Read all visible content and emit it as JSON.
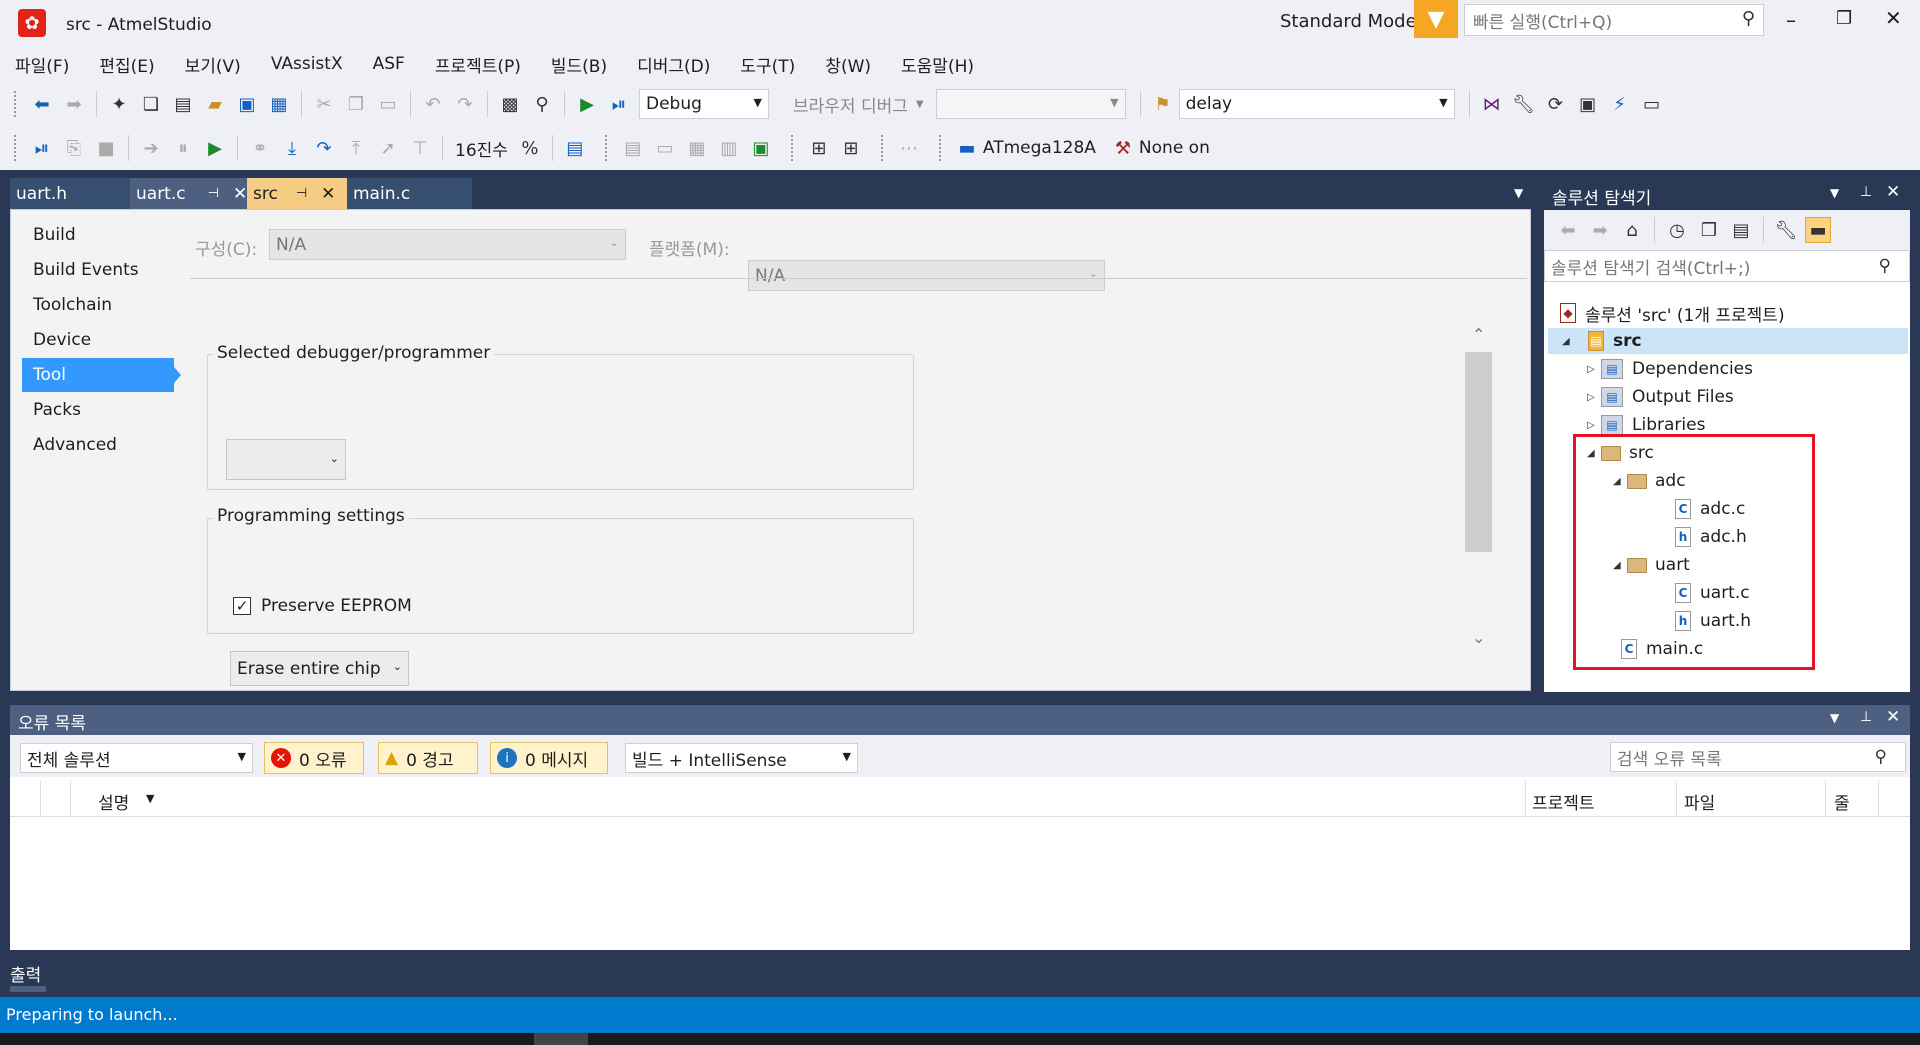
{
  "window": {
    "title": "src - AtmelStudio",
    "mode": "Standard Mode",
    "quick_launch_placeholder": "빠른 실행(Ctrl+Q)"
  },
  "menu": [
    "파일(F)",
    "편집(E)",
    "보기(V)",
    "VAssistX",
    "ASF",
    "프로젝트(P)",
    "빌드(B)",
    "디버그(D)",
    "도구(T)",
    "창(W)",
    "도움말(H)"
  ],
  "toolbar": {
    "config": "Debug",
    "browser_debugger": "브라우저 디버그",
    "search_value": "delay",
    "hex_label": "16진수",
    "device": "ATmega128A",
    "tool": "None on"
  },
  "tabs": [
    {
      "label": "uart.h"
    },
    {
      "label": "uart.c"
    },
    {
      "label": "src"
    },
    {
      "label": "main.c"
    }
  ],
  "props": {
    "nav": [
      "Build",
      "Build Events",
      "Toolchain",
      "Device",
      "Tool",
      "Packs",
      "Advanced"
    ],
    "selected_nav": "Tool",
    "config_label": "구성(C):",
    "config_value": "N/A",
    "platform_label": "플랫폼(M):",
    "platform_value": "N/A",
    "debugger_group": "Selected debugger/programmer",
    "programming_group": "Programming settings",
    "erase_value": "Erase entire chip",
    "preserve_eeprom": "Preserve EEPROM",
    "preserve_checked": true
  },
  "solution_explorer": {
    "title": "솔루션 탐색기",
    "search_placeholder": "솔루션 탐색기 검색(Ctrl+;)",
    "solution": "솔루션 'src' (1개 프로젝트)",
    "project": "src",
    "items": [
      "Dependencies",
      "Output Files",
      "Libraries"
    ],
    "folder_src": "src",
    "folder_adc": "adc",
    "adc_c": "adc.c",
    "adc_h": "adc.h",
    "folder_uart": "uart",
    "uart_c": "uart.c",
    "uart_h": "uart.h",
    "main_c": "main.c",
    "highlight_color": "#e81123"
  },
  "error_list": {
    "title": "오류 목록",
    "scope": "전체 솔루션",
    "errors": "0 오류",
    "warnings": "0 경고",
    "messages": "0 메시지",
    "filter": "빌드 + IntelliSense",
    "search_placeholder": "검색 오류 목록",
    "columns": {
      "desc": "설명",
      "project": "프로젝트",
      "file": "파일",
      "line": "줄"
    }
  },
  "output_tab": "출력",
  "status": "Preparing to launch...",
  "colors": {
    "accent": "#007acc",
    "filter": "#f5a623",
    "selected": "#3399ff"
  }
}
